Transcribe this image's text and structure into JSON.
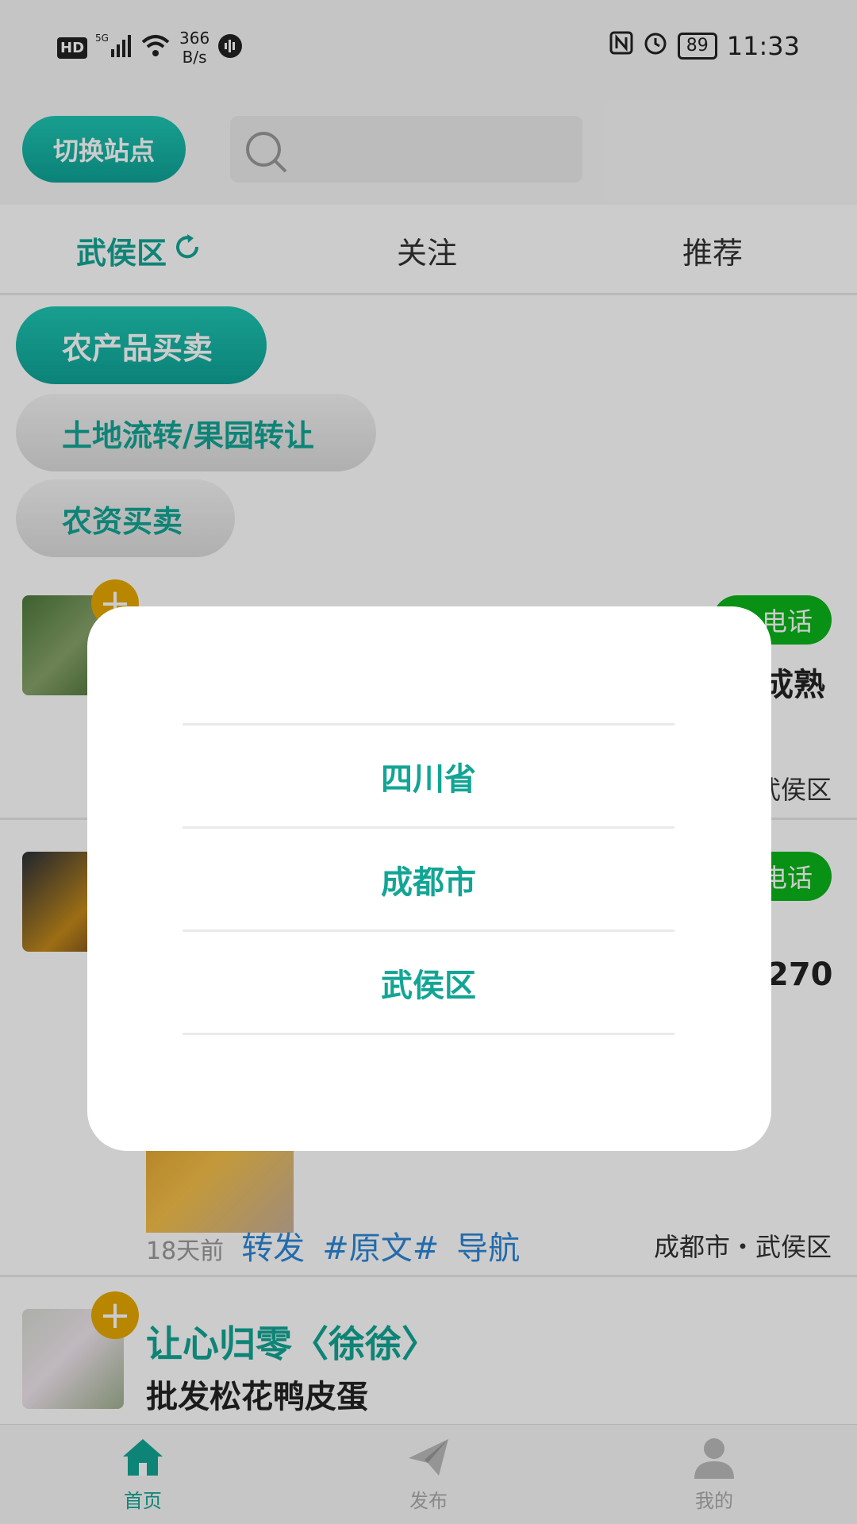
{
  "status_bar": {
    "hd": "HD",
    "network": "5G",
    "speed_value": "366",
    "speed_unit": "B/s",
    "battery": "89",
    "time": "11:33"
  },
  "header": {
    "switch_site_label": "切换站点",
    "search_placeholder": ""
  },
  "tabs": [
    {
      "label": "武侯区",
      "active": true
    },
    {
      "label": "关注",
      "active": false
    },
    {
      "label": "推荐",
      "active": false
    }
  ],
  "category_chips": [
    {
      "label": "农产品买卖",
      "active": true
    },
    {
      "label": "土地流转/果园转让",
      "active": false
    },
    {
      "label": "农资买卖",
      "active": false
    }
  ],
  "posts": [
    {
      "call_label": "电话",
      "text_fragment": "成熟",
      "location_fragment": "武侯区"
    },
    {
      "call_label": "电话",
      "text_fragment": "270",
      "time": "18天前",
      "actions": [
        "转发",
        "#原文#",
        "导航"
      ],
      "location": "成都市・武侯区"
    },
    {
      "author": "让心归零〈徐徐〉",
      "text": "批发松花鸭皮蛋"
    }
  ],
  "dialog": {
    "options": [
      "四川省",
      "成都市",
      "武侯区"
    ]
  },
  "bottom_nav": [
    {
      "label": "首页",
      "icon": "home-icon",
      "active": true
    },
    {
      "label": "发布",
      "icon": "paper-plane-icon",
      "active": false
    },
    {
      "label": "我的",
      "icon": "user-icon",
      "active": false
    }
  ],
  "colors": {
    "accent": "#12a595",
    "call_green": "#0bb61a",
    "plus_orange": "#e8a800",
    "link_blue": "#2c86d8"
  }
}
